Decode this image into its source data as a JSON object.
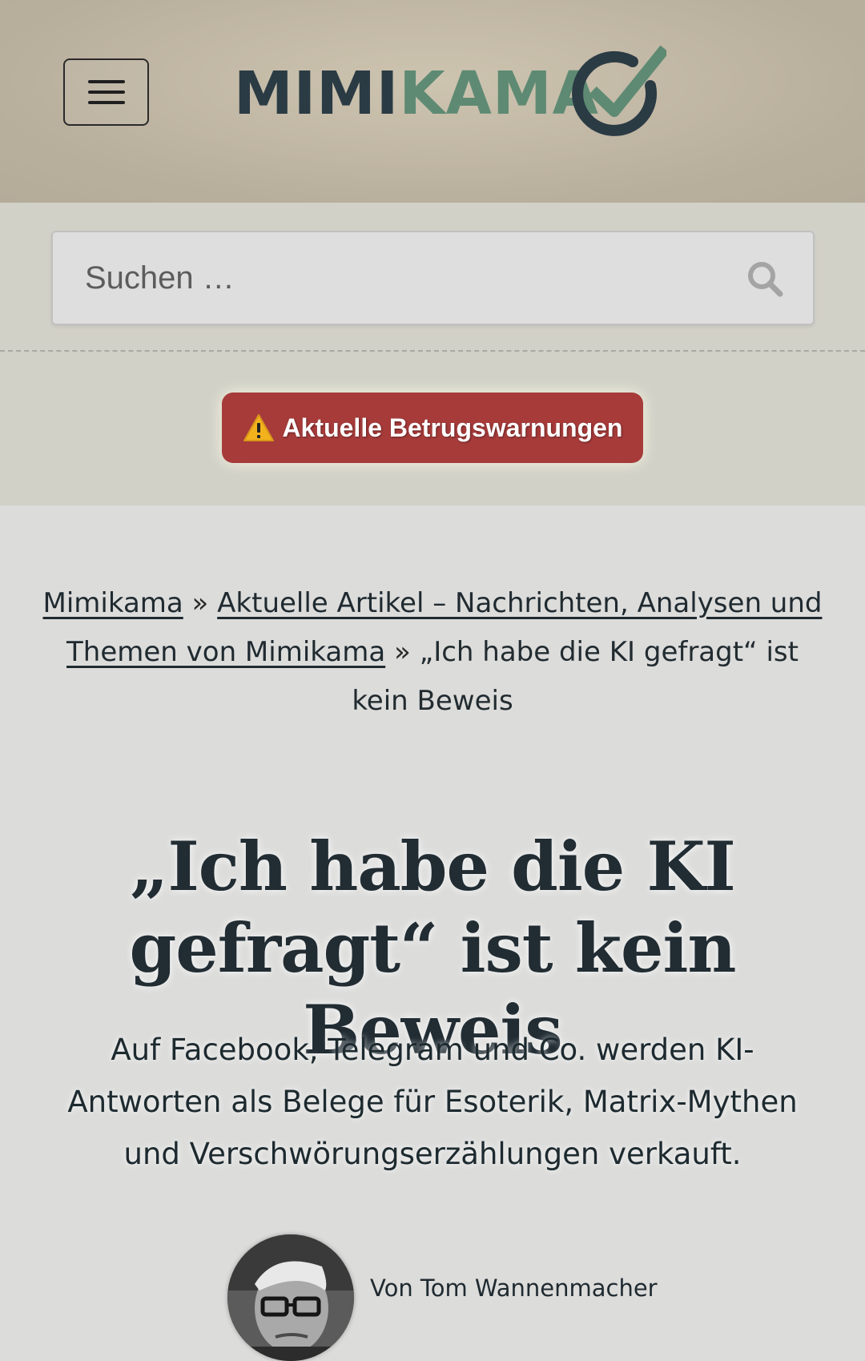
{
  "header": {
    "menu_icon": "hamburger-icon",
    "logo": {
      "text_dark_1": "MIMI",
      "text_green": "KAMA",
      "mark_icon": "checkmark-circle-icon",
      "color_dark": "#2b3b44",
      "color_green": "#5e8a73"
    }
  },
  "search": {
    "placeholder": "Suchen …",
    "icon": "search-icon"
  },
  "warning_button": {
    "icon": "warning-icon",
    "label": "Aktuelle Betrugswarnungen",
    "color": "#a63b3a"
  },
  "breadcrumb": {
    "home": "Mimikama",
    "separator": "»",
    "category": "Aktuelle Artikel – Nachrichten, Analysen und Themen von Mimikama",
    "current": "„Ich habe die KI gefragt“ ist kein Beweis"
  },
  "article": {
    "title": "„Ich habe die KI gefragt“ ist kein Beweis",
    "subtitle": "Auf Facebook, Telegram und Co. werden KI-Antworten als Belege für Esoterik, Matrix-Mythen und Verschwörungserzählungen verkauft.",
    "author": "Von Tom Wannenmacher"
  }
}
